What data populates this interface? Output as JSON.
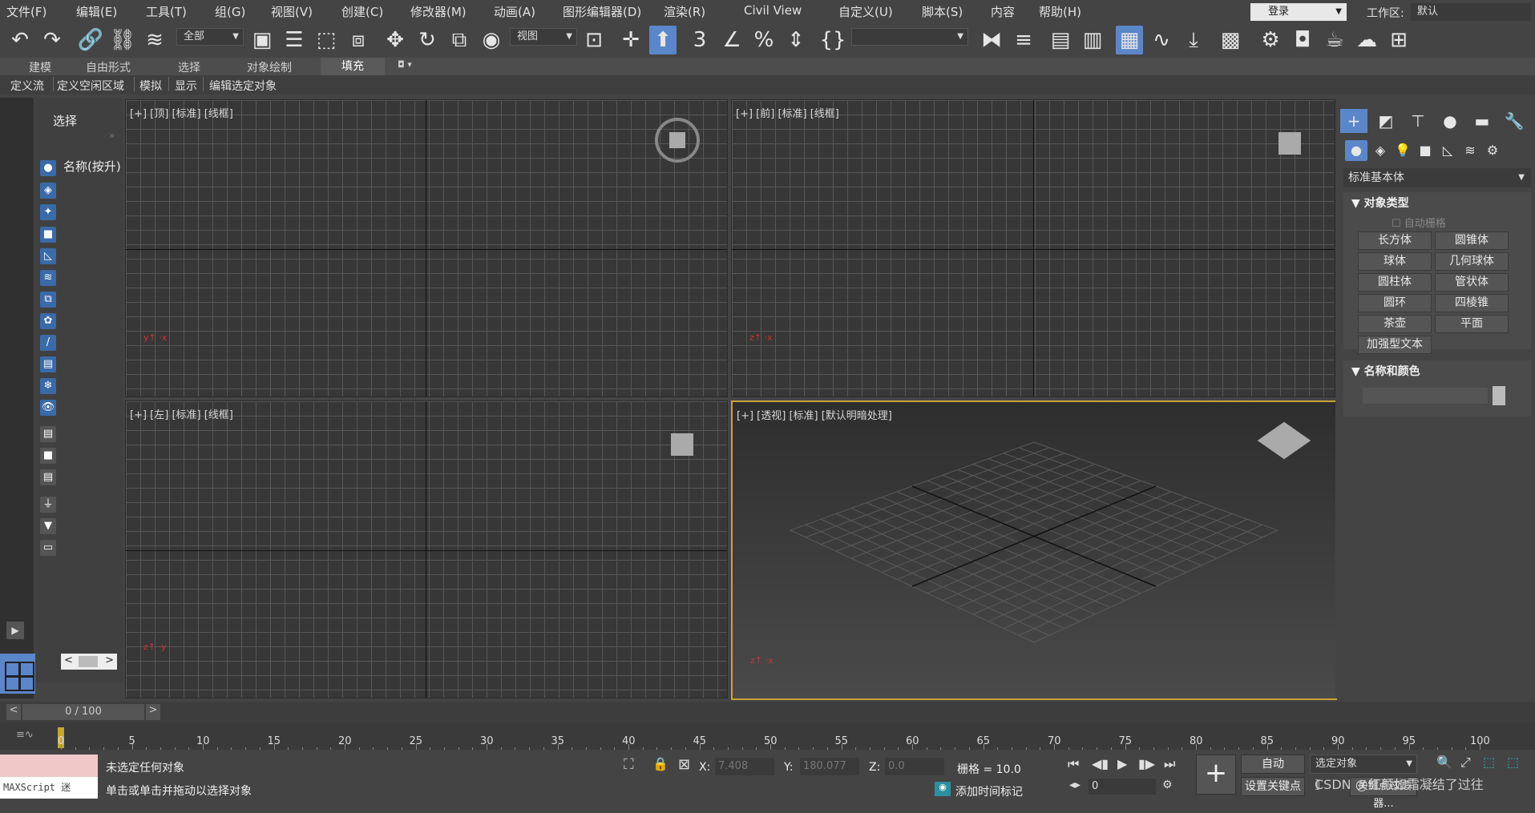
{
  "menu": [
    "文件(F)",
    "编辑(E)",
    "工具(T)",
    "组(G)",
    "视图(V)",
    "创建(C)",
    "修改器(M)",
    "动画(A)",
    "图形编辑器(D)",
    "渲染(R)",
    "Civil View",
    "自定义(U)",
    "脚本(S)",
    "内容",
    "帮助(H)"
  ],
  "login": "登录",
  "workspace_label": "工作区:",
  "workspace_value": "默认",
  "toolbar": {
    "filter_all": "全部",
    "ref_coord": "视图",
    "named_sel": ""
  },
  "ribbon_tabs": [
    "建模",
    "自由形式",
    "选择",
    "对象绘制",
    "填充"
  ],
  "ribbon_active": "填充",
  "ribbon_row2": [
    "定义流",
    "定义空闲区域",
    "模拟",
    "显示",
    "编辑选定对象"
  ],
  "scene": {
    "select_label": "选择",
    "name_label": "名称(按升)"
  },
  "viewports": {
    "top": {
      "label": "[+] [顶] [标准] [线框]"
    },
    "front": {
      "label": "[+] [前] [标准] [线框]"
    },
    "left": {
      "label": "[+] [左] [标准] [线框]"
    },
    "persp": {
      "label": "[+] [透视] [标准] [默认明暗处理]"
    }
  },
  "cmd": {
    "dropdown": "标准基本体",
    "object_type_title": "对象类型",
    "autogrid": "自动栅格",
    "buttons": [
      "长方体",
      "圆锥体",
      "球体",
      "几何球体",
      "圆柱体",
      "管状体",
      "圆环",
      "四棱锥",
      "茶壶",
      "平面",
      "加强型文本"
    ],
    "name_color_title": "名称和颜色"
  },
  "timeslider": {
    "value": "0 / 100"
  },
  "timeline": {
    "ticks": [
      "0",
      "5",
      "10",
      "15",
      "20",
      "25",
      "30",
      "35",
      "40",
      "45",
      "50",
      "55",
      "60",
      "65",
      "70",
      "75",
      "80",
      "85",
      "90",
      "95",
      "100"
    ]
  },
  "status": {
    "maxscript": "MAXScript 迷",
    "line1": "未选定任何对象",
    "line2": "单击或单击并拖动以选择对象",
    "x_label": "X:",
    "x_value": "7.408",
    "y_label": "Y:",
    "y_value": "180.077",
    "z_label": "Z:",
    "z_value": "0.0",
    "grid": "栅格 = 10.0",
    "add_time_tag": "添加时间标记",
    "auto": "自动",
    "selected_obj": "选定对象",
    "set_key": "设置关键点",
    "key_filter": "关键点过滤器...",
    "frame": "0",
    "watermark": "CSDN @红颜如霜凝结了过往"
  }
}
